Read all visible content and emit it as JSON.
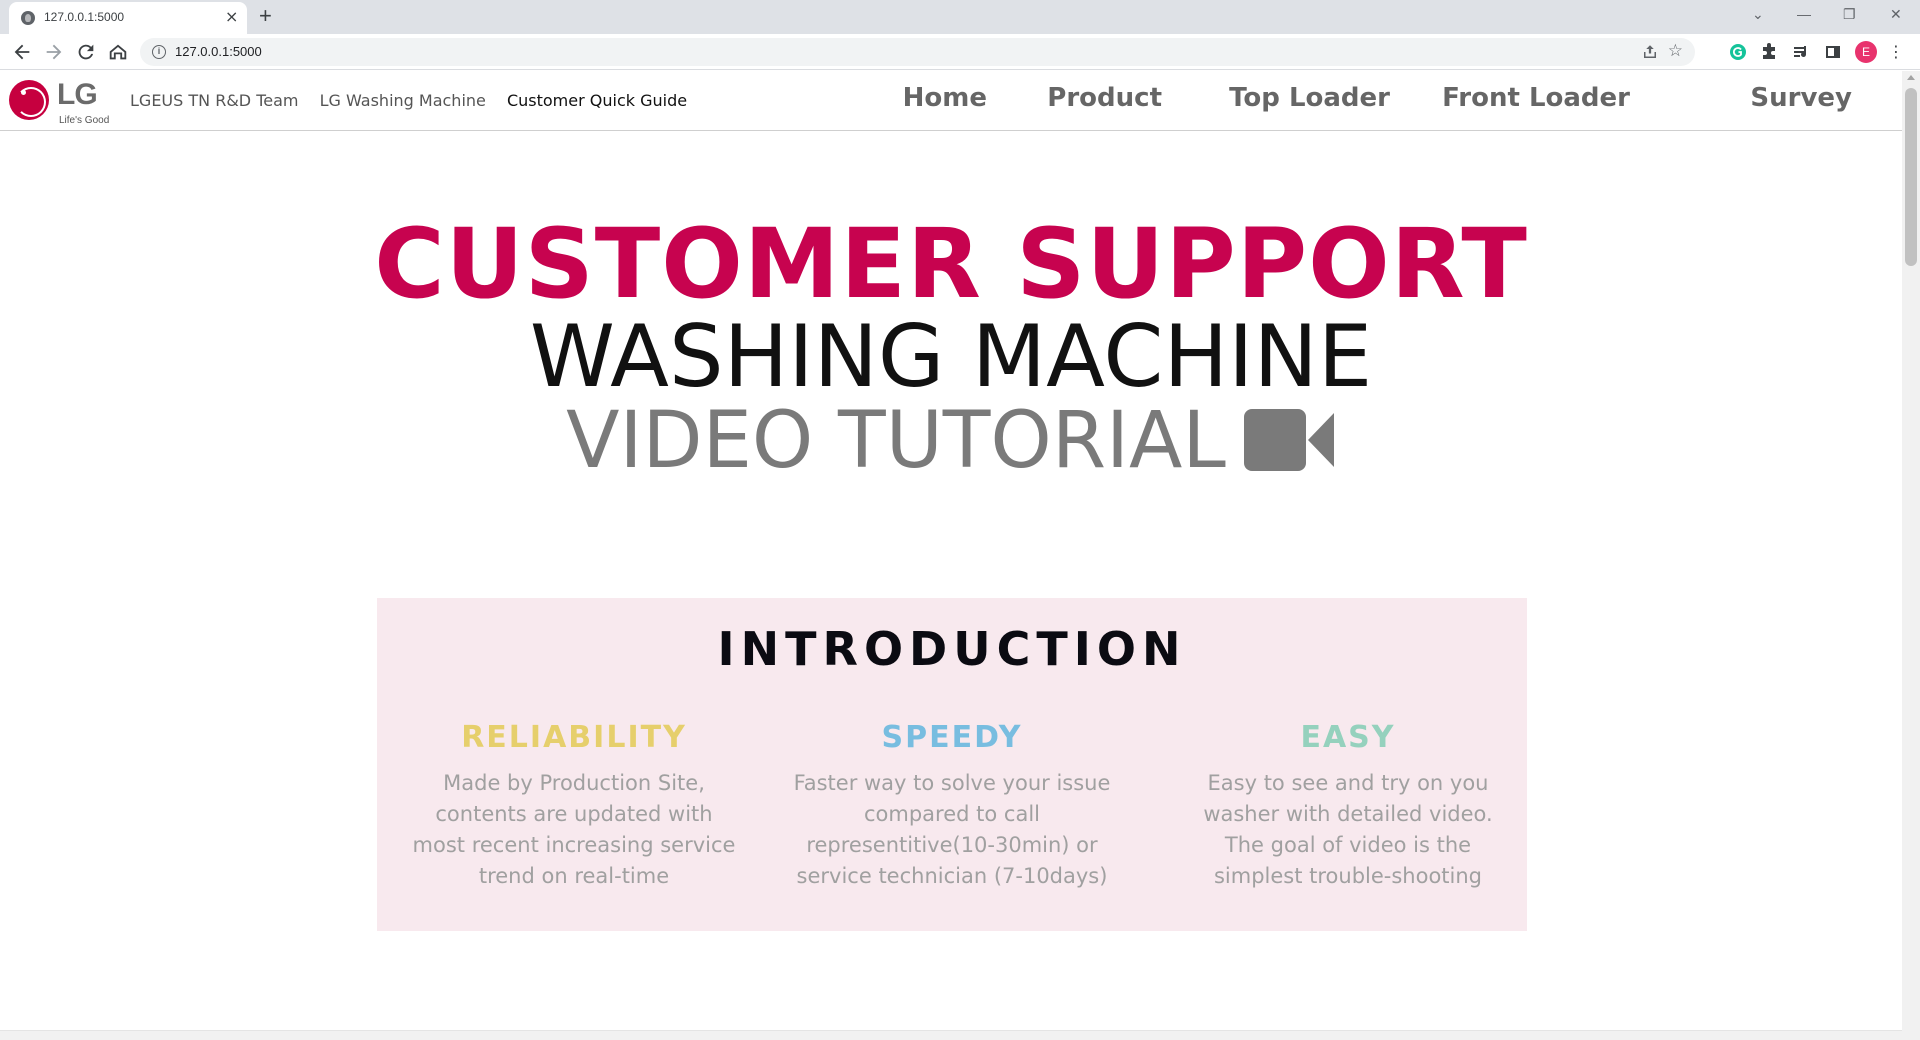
{
  "browser": {
    "tab_title": "127.0.0.1:5000",
    "tab_close": "×",
    "new_tab": "+",
    "url": "127.0.0.1:5000",
    "profile_initial": "E",
    "window_controls": [
      "⌄",
      "—",
      "❐",
      "✕"
    ]
  },
  "site": {
    "logo_text": "LG",
    "logo_tagline": "Life's Good",
    "breadcrumb": [
      "LGEUS TN R&D Team",
      "LG Washing Machine",
      "Customer Quick Guide"
    ],
    "nav": [
      "Home",
      "Product",
      "Top Loader",
      "Front Loader",
      "Survey"
    ]
  },
  "hero": {
    "line1": "CUSTOMER SUPPORT",
    "line2": "WASHING MACHINE",
    "line3": "VIDEO TUTORIAL",
    "icon": "video-camera-icon"
  },
  "intro": {
    "title": "INTRODUCTION",
    "features": [
      {
        "title": "RELIABILITY",
        "color": "#e6cf6c",
        "body": "Made by Production Site, contents are updated with most recent increasing service trend on real-time"
      },
      {
        "title": "SPEEDY",
        "color": "#78bde0",
        "body": "Faster way to solve your issue compared to call representitive(10-30min) or service technician (7-10days)"
      },
      {
        "title": "EASY",
        "color": "#95d1bd",
        "body": "Easy to see and try on you washer with detailed video. The goal of video is the simplest trouble-shooting"
      }
    ]
  },
  "colors": {
    "brand": "#c7034f",
    "intro_bg": "#f8e9ee"
  }
}
